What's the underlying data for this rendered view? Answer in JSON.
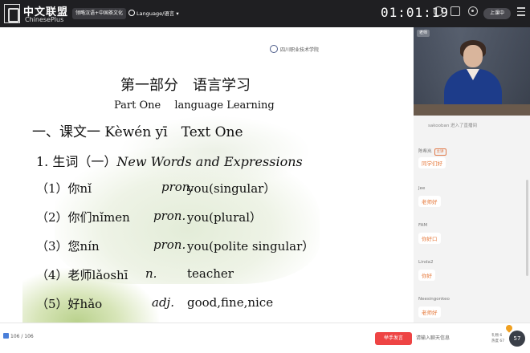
{
  "topbar": {
    "logo_cn": "中文联盟",
    "logo_en": "ChinesePlus",
    "course": "领略汉语+中国茶文化",
    "language": "Language/语言",
    "timer": "01:01:19",
    "class_button": "上课中"
  },
  "slide": {
    "school": "四川职业技术学院",
    "title_cn": "第一部分　语言学习",
    "title_en": "Part One　 language Learning",
    "lesson": "一、课文一 Kèwén yī　Text One",
    "vocab_head_cn": "1. 生词（一）",
    "vocab_head_en": "New Words and Expressions",
    "vocab": [
      {
        "word": "（1）你nǐ",
        "pos": "pron.",
        "meaning": "you(singular）"
      },
      {
        "word": "（2）你们nǐmen",
        "pos": "pron.",
        "meaning": "you(plural）"
      },
      {
        "word": "（3）您nín",
        "pos": "pron.",
        "meaning": "you(polite singular）"
      },
      {
        "word": "（4）老师lǎoshī",
        "pos": "n.",
        "meaning": "teacher"
      },
      {
        "word": "（5）好hǎo",
        "pos": "adj.",
        "meaning": "good,fine,nice"
      }
    ]
  },
  "teacher_video": {
    "tag": "老师"
  },
  "chat": {
    "join_notice": "sakooban 进入了直播间",
    "messages": [
      {
        "name": "陈希岚",
        "tag": "主讲",
        "text": "同学们好"
      },
      {
        "name": "Jee",
        "text": "老师好"
      },
      {
        "name": "FAM",
        "text": "你好口"
      },
      {
        "name": "Linda2",
        "text": "你好"
      },
      {
        "name": "Neesingonkeo",
        "text": "老师好"
      }
    ]
  },
  "bottombar": {
    "page_indicator": "106 / 106",
    "raise_hand": "举手发言",
    "chat_placeholder": "请输入聊天信息",
    "reward_line1": "礼物 6",
    "reward_line2": "热度 67",
    "reward_count": "57"
  }
}
